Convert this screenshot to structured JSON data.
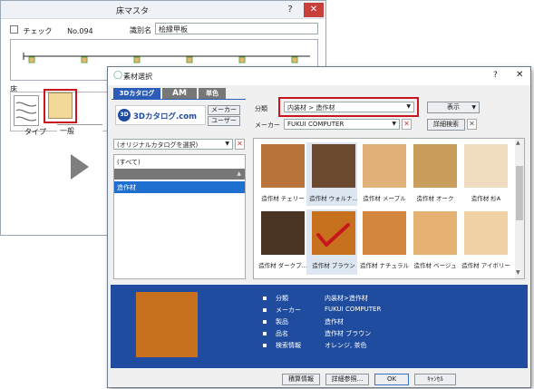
{
  "bg_window": {
    "title": "床マスタ",
    "help": "?",
    "check_label": "チェック",
    "number": "No.094",
    "name_label": "識別名",
    "name_value": "桧縁甲板",
    "floor_label": "床",
    "type_label": "タイプ",
    "type_value": "一般"
  },
  "dialog": {
    "title": "素材選択",
    "help": "?",
    "tabs": [
      "3Dカタログ",
      "AM",
      "単色"
    ],
    "logo_text": "3Dカタログ.com",
    "maker_btn": "メーカー",
    "user_btn": "ユーザー",
    "category_label": "分類",
    "category_value": "内装材 > 造作材",
    "maker_label": "メーカー",
    "maker_value": "FUKUI COMPUTER",
    "display_btn": "表示",
    "detail_search_btn": "詳細検索",
    "catalog_select": "(オリジナルカタログを選択)",
    "tree": [
      "(すべて)",
      "造作材"
    ],
    "swatches": [
      {
        "label": "造作材 チェリー",
        "color": "#b8743a"
      },
      {
        "label": "造作材 ウォルナ...",
        "color": "#6b4a30"
      },
      {
        "label": "造作材 メープル",
        "color": "#e2b17a"
      },
      {
        "label": "造作材 オーク",
        "color": "#c99e5c"
      },
      {
        "label": "造作材 杉A",
        "color": "#f1dcc0"
      },
      {
        "label": "造作材 ダークブ...",
        "color": "#4a3424"
      },
      {
        "label": "造作材 ブラウン",
        "color": "#c7711e"
      },
      {
        "label": "造作材 ナチュラル",
        "color": "#d3873e"
      },
      {
        "label": "造作材 ベージュ",
        "color": "#e5b273"
      },
      {
        "label": "造作材 アイボリー",
        "color": "#f0d2a4"
      }
    ],
    "info": {
      "preview_color": "#c7711e",
      "rows": [
        {
          "k": "分類",
          "v": "内装材>造作材"
        },
        {
          "k": "メーカー",
          "v": "FUKUI COMPUTER"
        },
        {
          "k": "製品",
          "v": "造作材"
        },
        {
          "k": "品名",
          "v": "造作材 ブラウン"
        },
        {
          "k": "検索情報",
          "v": "オレンジ, 茶色"
        }
      ]
    },
    "buttons": {
      "estimate": "積算情報",
      "detail_ref": "詳細参照...",
      "ok": "OK",
      "cancel": "ｷｬﾝｾﾙ"
    }
  },
  "highlight_color": "#c8161d"
}
